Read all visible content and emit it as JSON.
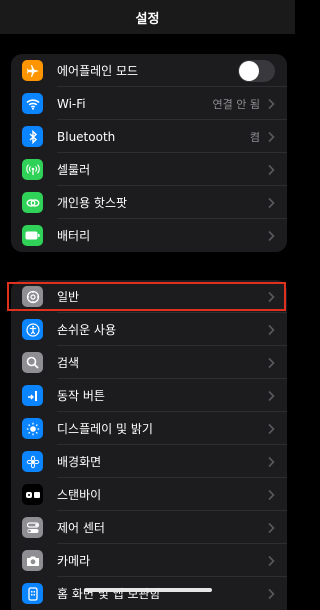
{
  "header": {
    "title": "설정"
  },
  "groups": {
    "connectivity": [
      {
        "label": "에어플레인 모드",
        "icon": "airplane-icon",
        "color": "#ff9500"
      },
      {
        "label": "Wi-Fi",
        "value": "연결 안 됨",
        "icon": "wifi-icon",
        "color": "#0a84ff"
      },
      {
        "label": "Bluetooth",
        "value": "켬",
        "icon": "bluetooth-icon",
        "color": "#0a84ff"
      },
      {
        "label": "셀룰러",
        "icon": "cellular-icon",
        "color": "#30d158"
      },
      {
        "label": "개인용 핫스팟",
        "icon": "hotspot-icon",
        "color": "#30d158"
      },
      {
        "label": "배터리",
        "icon": "battery-icon",
        "color": "#30d158"
      }
    ],
    "system": [
      {
        "label": "일반",
        "icon": "gear-icon",
        "color": "#8e8e93"
      },
      {
        "label": "손쉬운 사용",
        "icon": "accessibility-icon",
        "color": "#0a84ff"
      },
      {
        "label": "검색",
        "icon": "search-icon",
        "color": "#8e8e93"
      },
      {
        "label": "동작 버튼",
        "icon": "action-button-icon",
        "color": "#0a84ff"
      },
      {
        "label": "디스플레이 및 밝기",
        "icon": "brightness-icon",
        "color": "#0a84ff"
      },
      {
        "label": "배경화면",
        "icon": "wallpaper-icon",
        "color": "#0a84ff"
      },
      {
        "label": "스탠바이",
        "icon": "standby-icon",
        "color": "#1c1c1e"
      },
      {
        "label": "제어 센터",
        "icon": "control-center-icon",
        "color": "#8e8e93"
      },
      {
        "label": "카메라",
        "icon": "camera-icon",
        "color": "#8e8e93"
      },
      {
        "label": "홈 화면 및 앱 보관함",
        "icon": "home-screen-icon",
        "color": "#0a84ff"
      }
    ]
  },
  "airplane_mode_on": false,
  "highlight_color": "#e0301e"
}
